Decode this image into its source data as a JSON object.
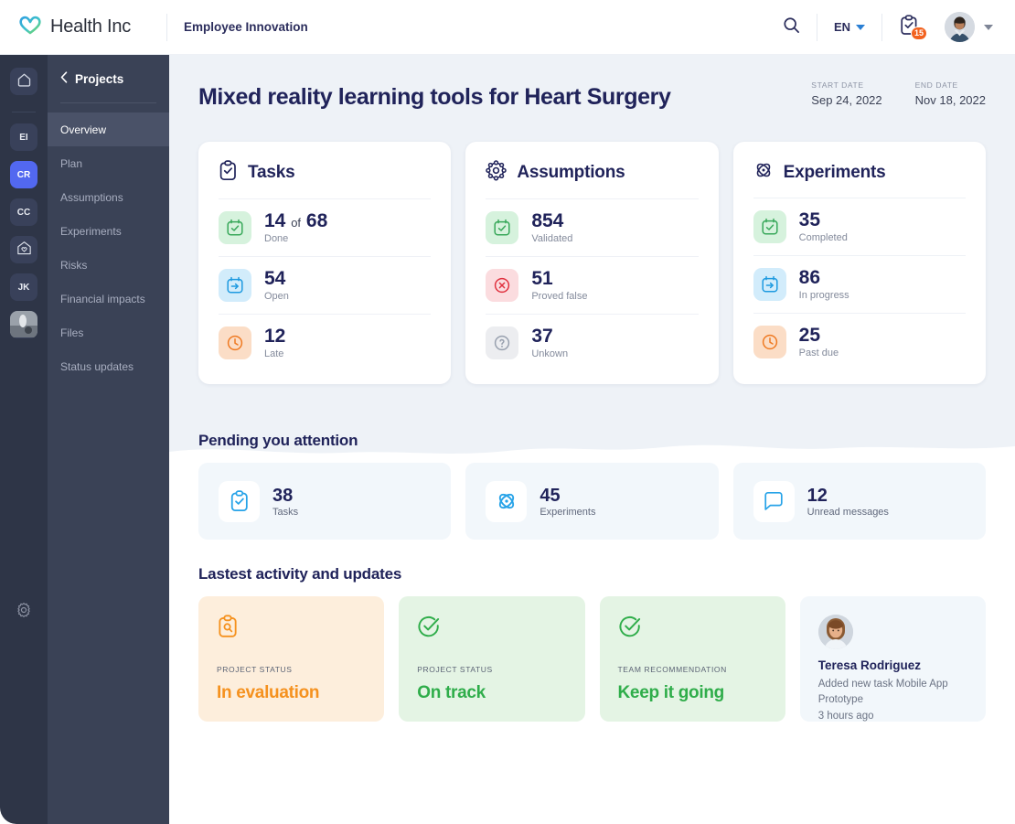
{
  "topbar": {
    "logo_icon": "heart-logo-icon",
    "brand": "Health Inc",
    "breadcrumb": "Employee Innovation",
    "search_icon": "search-icon",
    "language": "EN",
    "notifications_icon": "clipboard-check-icon",
    "notifications_badge": "15",
    "avatar_icon": "user-avatar",
    "profile_caret_icon": "chevron-down-icon"
  },
  "rail": {
    "home_icon": "home-icon",
    "settings_icon": "gear-icon",
    "workspaces": [
      {
        "label": "EI",
        "active": false
      },
      {
        "label": "CR",
        "active": true
      },
      {
        "label": "CC",
        "active": false
      },
      {
        "label": "",
        "active": false,
        "icon": "health-house-icon"
      },
      {
        "label": "JK",
        "active": false
      },
      {
        "label": "",
        "active": false,
        "icon": "workspace-photo"
      }
    ]
  },
  "sidebar": {
    "back_icon": "chevron-left-icon",
    "header": "Projects",
    "items": [
      {
        "label": "Overview",
        "active": true
      },
      {
        "label": "Plan",
        "active": false
      },
      {
        "label": "Assumptions",
        "active": false
      },
      {
        "label": "Experiments",
        "active": false
      },
      {
        "label": "Risks",
        "active": false
      },
      {
        "label": "Financial impacts",
        "active": false
      },
      {
        "label": "Files",
        "active": false
      },
      {
        "label": "Status updates",
        "active": false
      }
    ]
  },
  "page": {
    "title": "Mixed reality learning tools for Heart Surgery",
    "start_date_label": "START DATE",
    "start_date_value": "Sep 24, 2022",
    "end_date_label": "END DATE",
    "end_date_value": "Nov 18, 2022"
  },
  "stat_cards": [
    {
      "title": "Tasks",
      "icon": "clipboard-check-icon",
      "rows": [
        {
          "icon": "calendar-check-icon",
          "tone": "green",
          "value": "14",
          "of_text": "of",
          "total": "68",
          "label": "Done"
        },
        {
          "icon": "calendar-arrow-icon",
          "tone": "blue",
          "value": "54",
          "label": "Open"
        },
        {
          "icon": "clock-icon",
          "tone": "orange",
          "value": "12",
          "label": "Late"
        }
      ]
    },
    {
      "title": "Assumptions",
      "icon": "cog-nodes-icon",
      "rows": [
        {
          "icon": "calendar-check-icon",
          "tone": "green",
          "value": "854",
          "label": "Validated"
        },
        {
          "icon": "circle-x-icon",
          "tone": "red",
          "value": "51",
          "label": "Proved false"
        },
        {
          "icon": "circle-question-icon",
          "tone": "gray",
          "value": "37",
          "label": "Unkown"
        }
      ]
    },
    {
      "title": "Experiments",
      "icon": "atom-icon",
      "rows": [
        {
          "icon": "calendar-check-icon",
          "tone": "green",
          "value": "35",
          "label": "Completed"
        },
        {
          "icon": "calendar-arrow-icon",
          "tone": "blue",
          "value": "86",
          "label": "In progress"
        },
        {
          "icon": "clock-icon",
          "tone": "orange",
          "value": "25",
          "label": "Past due"
        }
      ]
    }
  ],
  "pending": {
    "title": "Pending you attention",
    "cards": [
      {
        "icon": "clipboard-check-icon",
        "value": "38",
        "label": "Tasks"
      },
      {
        "icon": "atom-icon",
        "value": "45",
        "label": "Experiments"
      },
      {
        "icon": "message-icon",
        "value": "12",
        "label": "Unread messages"
      }
    ]
  },
  "activity": {
    "title": "Lastest activity and updates",
    "cards": [
      {
        "kind": "status",
        "tone": "orange",
        "icon": "clipboard-search-icon",
        "kicker": "PROJECT STATUS",
        "value": "In evaluation"
      },
      {
        "kind": "status",
        "tone": "green",
        "icon": "check-circle-icon",
        "kicker": "PROJECT STATUS",
        "value": "On track"
      },
      {
        "kind": "status",
        "tone": "green",
        "icon": "check-circle-icon",
        "kicker": "TEAM RECOMMENDATION",
        "value": "Keep it going"
      }
    ],
    "person": {
      "avatar_icon": "user-avatar",
      "name": "Teresa Rodriguez",
      "description": "Added new task Mobile App Prototype",
      "time": "3 hours ago"
    }
  },
  "colors": {
    "accent_blue": "#5268f0",
    "rail_bg": "#2e3547",
    "sidebar_bg": "#3a4256",
    "hero_bg": "#eef2f7",
    "title_navy": "#20235a",
    "orange": "#f5911e",
    "green": "#2fad4a",
    "badge_orange": "#f2621f",
    "icon_blue": "#27a3e8"
  }
}
